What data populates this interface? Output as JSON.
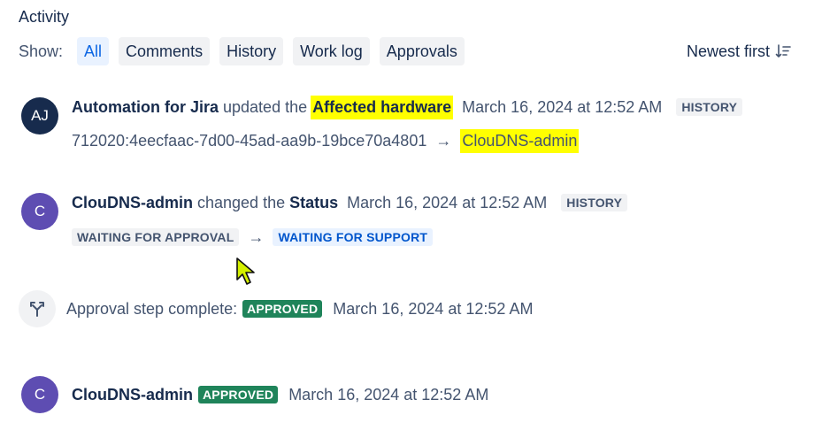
{
  "activity": {
    "title": "Activity",
    "show_label": "Show:",
    "filters": [
      "All",
      "Comments",
      "History",
      "Work log",
      "Approvals"
    ],
    "active_filter": "All",
    "sort_label": "Newest first"
  },
  "entries": [
    {
      "avatar_initials": "AJ",
      "author": "Automation for Jira",
      "action": "updated the",
      "field": "Affected hardware",
      "timestamp": "March 16, 2024 at 12:52 AM",
      "tag": "HISTORY",
      "old_value": "712020:4eecfaac-7d00-45ad-aa9b-19bce70a4801",
      "arrow": "→",
      "new_value": "ClouDNS-admin"
    },
    {
      "avatar_initials": "C",
      "author": "ClouDNS-admin",
      "action": "changed the",
      "field": "Status",
      "timestamp": "March 16, 2024 at 12:52 AM",
      "tag": "HISTORY",
      "old_value": "WAITING FOR APPROVAL",
      "arrow": "→",
      "new_value": "WAITING FOR SUPPORT"
    },
    {
      "icon": "approval-step-icon",
      "text": "Approval step complete:",
      "badge": "APPROVED",
      "timestamp": "March 16, 2024 at 12:52 AM"
    },
    {
      "avatar_initials": "C",
      "author": "ClouDNS-admin",
      "badge": "APPROVED",
      "timestamp": "March 16, 2024 at 12:52 AM"
    }
  ],
  "colors": {
    "primary_text": "#172b4d",
    "secondary_text": "#44546f",
    "highlight": "#ffff00",
    "approved_green": "#1f845a",
    "active_blue": "#0c66e4",
    "avatar_purple": "#5e4db2",
    "avatar_navy": "#172b4d"
  }
}
